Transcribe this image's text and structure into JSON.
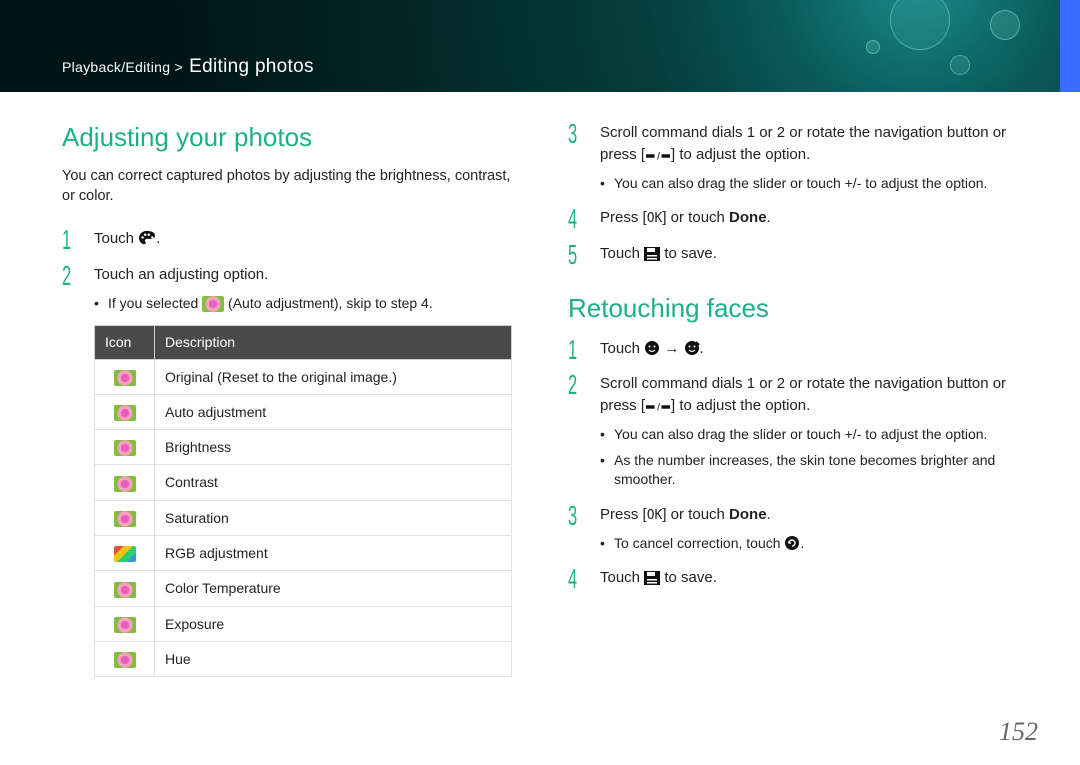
{
  "header": {
    "breadcrumb_prefix": "Playback/Editing >",
    "breadcrumb_title": "Editing photos"
  },
  "left": {
    "h2": "Adjusting your photos",
    "intro": "You can correct captured photos by adjusting the brightness, contrast, or color.",
    "step1_pre": "Touch ",
    "step1_post": ".",
    "step2": "Touch an adjusting option.",
    "step2_sub_pre": "If you selected ",
    "step2_sub_post": " (Auto adjustment), skip to step 4.",
    "table": {
      "h1": "Icon",
      "h2": "Description",
      "rows": [
        {
          "desc": "Original (Reset to the original image.)",
          "thumb": "th-flower"
        },
        {
          "desc": "Auto adjustment",
          "thumb": "th-flower"
        },
        {
          "desc": "Brightness",
          "thumb": "th-flower"
        },
        {
          "desc": "Contrast",
          "thumb": "th-flower"
        },
        {
          "desc": "Saturation",
          "thumb": "th-flower"
        },
        {
          "desc": "RGB adjustment",
          "thumb": "th-rgb"
        },
        {
          "desc": "Color Temperature",
          "thumb": "th-flower"
        },
        {
          "desc": "Exposure",
          "thumb": "th-flower"
        },
        {
          "desc": "Hue",
          "thumb": "th-flower"
        }
      ]
    }
  },
  "right": {
    "step3_a": "Scroll command dials 1 or 2 or rotate the navigation button or press [",
    "step3_b": "] to adjust the option.",
    "step3_sub": "You can also drag the slider or touch +/- to adjust the option.",
    "step4_a": "Press [",
    "step4_b": "] or touch ",
    "step4_done": "Done",
    "step4_c": ".",
    "step5_a": "Touch ",
    "step5_b": " to save.",
    "h2_retouch": "Retouching faces",
    "r1_a": "Touch ",
    "r1_arrow": " → ",
    "r1_b": ".",
    "r2_a": "Scroll command dials 1 or 2 or rotate the navigation button or press [",
    "r2_b": "] to adjust the option.",
    "r2_sub1": "You can also drag the slider or touch +/- to adjust the option.",
    "r2_sub2": "As the number increases, the skin tone becomes brighter and smoother.",
    "r3_a": "Press [",
    "r3_b": "] or touch ",
    "r3_done": "Done",
    "r3_c": ".",
    "r3_sub_a": "To cancel correction, touch ",
    "r3_sub_b": ".",
    "r4_a": "Touch ",
    "r4_b": " to save."
  },
  "page_number": "152",
  "icons": {
    "palette": "palette-icon",
    "disk": "save-icon",
    "ok": "ok-icon",
    "updown": "updown-icon",
    "face": "face-icon",
    "face2": "face-retouch-icon",
    "cancel": "cancel-icon"
  }
}
